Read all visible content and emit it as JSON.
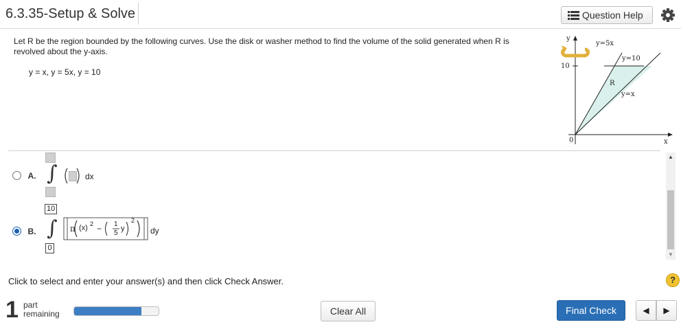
{
  "header": {
    "title": "6.3.35-Setup & Solve",
    "help_label": "Question Help"
  },
  "problem": {
    "text": "Let R be the region bounded by the following curves. Use the disk or washer method to find the volume of the solid generated when R is revolved about the y-axis.",
    "equations": "y = x, y = 5x, y = 10"
  },
  "graph": {
    "y_axis_label": "y",
    "x_axis_label": "x",
    "tick_y_label": "10",
    "origin_label": "0",
    "line1_label": "y=5x",
    "line2_label": "y=10",
    "region_label": "R",
    "line3_label": "y=x",
    "region_color": "#d9f0ec",
    "rotation_color": "#e2b13a"
  },
  "choices": [
    {
      "letter": "A.",
      "selected": false,
      "dvar": "dx"
    },
    {
      "letter": "B.",
      "selected": true,
      "upper": "10",
      "lower": "0",
      "pi": "π",
      "term1": "(x)",
      "exp1": "2",
      "minus": "−",
      "frac_num": "1",
      "frac_den": "5",
      "frac_var": "y",
      "exp2": "2",
      "dvar": "dy"
    }
  ],
  "instruction": "Click to select and enter your answer(s) and then click Check Answer.",
  "help_symbol": "?",
  "footer": {
    "parts_count": "1",
    "parts_word": "part",
    "parts_remaining": "remaining",
    "progress": 0.8,
    "clear_label": "Clear All",
    "final_label": "Final Check",
    "prev_symbol": "◀",
    "next_symbol": "▶"
  },
  "colors": {
    "accent": "#2a6fb5",
    "progress_fill": "#3d7fc4",
    "help_bg": "#f0c330"
  }
}
